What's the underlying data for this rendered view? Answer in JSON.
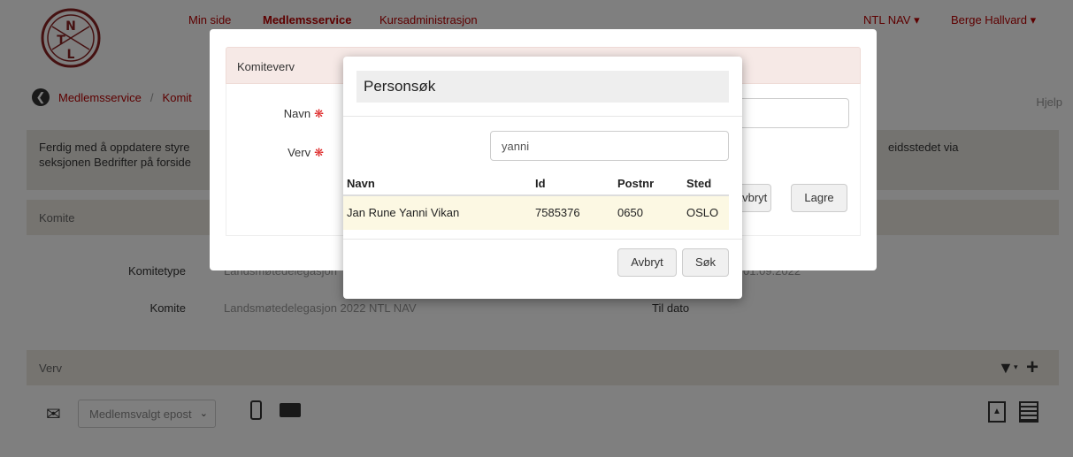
{
  "header": {
    "logo_text": "NTL",
    "nav": [
      "Min side",
      "Medlemsservice",
      "Kursadministrasjon"
    ],
    "user_menu": [
      "NTL NAV ▾",
      "Berge Hallvard ▾"
    ]
  },
  "breadcrumb": {
    "items": [
      "Medlemsservice",
      "/",
      "Komit"
    ]
  },
  "help_label": "Hjelp",
  "notice": {
    "line1_left": "Ferdig med å oppdatere styre",
    "line1_right": "eidsstedet via",
    "line2": "seksjonen Bedrifter på forside"
  },
  "komite_panel": {
    "title": "Komite",
    "komitetype_label": "Komitetype",
    "komitetype_value": "Landsmøtedelegasjon",
    "fra_dato_value": "01.09.2022",
    "komite_label": "Komite",
    "komite_value": "Landsmøtedelegasjon 2022 NTL NAV",
    "til_dato_label": "Til dato"
  },
  "verv_panel": {
    "title": "Verv",
    "select_value": "Medlemsvalgt epost"
  },
  "modal_komiteverv": {
    "title": "Komiteverv",
    "navn_label": "Navn",
    "verv_label": "Verv",
    "cancel": "Avbryt",
    "save": "Lagre"
  },
  "modal_personsok": {
    "title": "Personsøk",
    "search_value": "yanni",
    "columns": [
      "Navn",
      "Id",
      "Postnr",
      "Sted"
    ],
    "rows": [
      {
        "navn": "Jan Rune Yanni Vikan",
        "id": "7585376",
        "postnr": "0650",
        "sted": "OSLO"
      }
    ],
    "cancel": "Avbryt",
    "search_button": "Søk"
  },
  "colors": {
    "accent": "#b00000",
    "required": "#d22222",
    "highlight_row": "#fcf8e3"
  }
}
